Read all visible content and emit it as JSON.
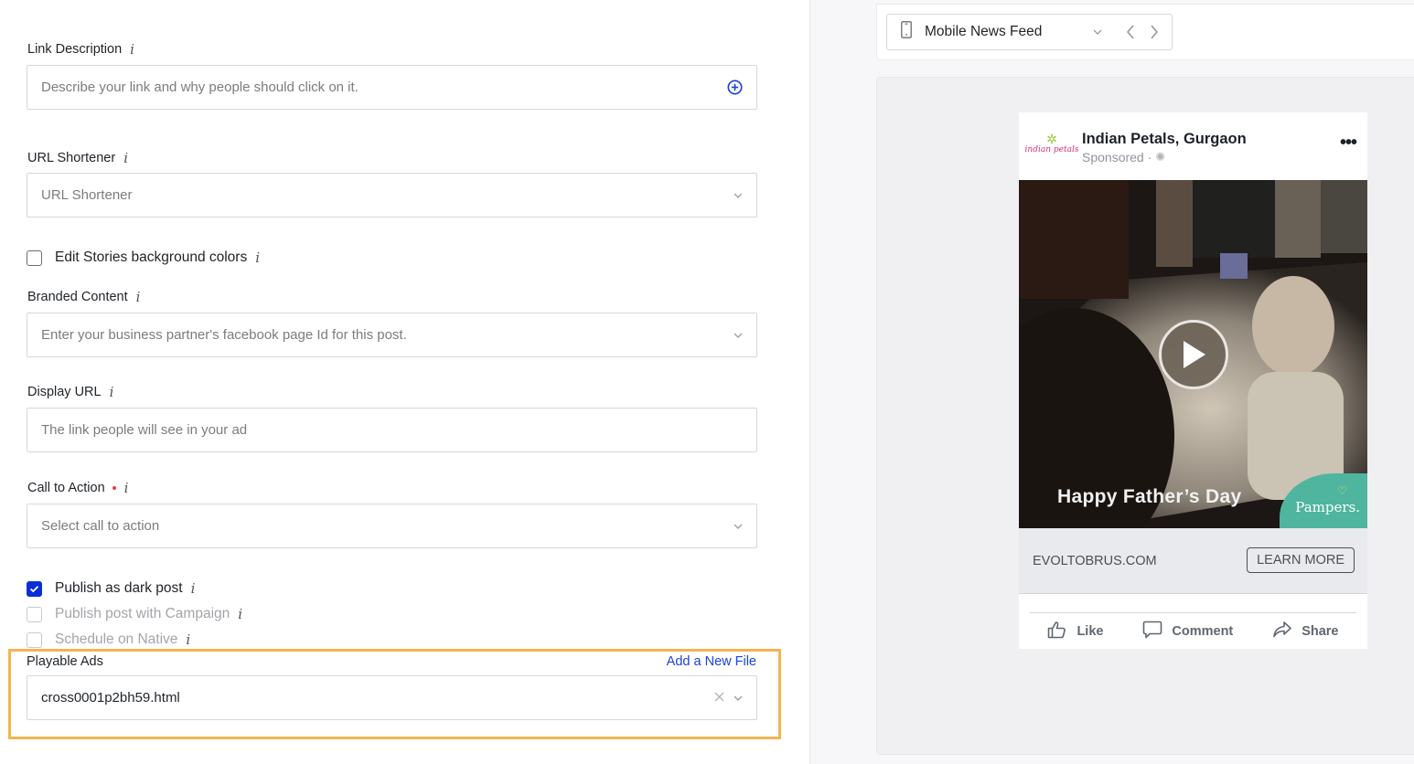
{
  "form": {
    "link_description": {
      "label": "Link Description",
      "info": "i",
      "placeholder": "Describe your link and why people should click on it."
    },
    "url_shortener": {
      "label": "URL Shortener",
      "info": "i",
      "placeholder": "URL Shortener"
    },
    "edit_stories_bg": {
      "label": "Edit Stories background colors",
      "info": "i",
      "checked": false
    },
    "branded_content": {
      "label": "Branded Content",
      "info": "i",
      "placeholder": "Enter your business partner's facebook page Id for this post."
    },
    "display_url": {
      "label": "Display URL",
      "info": "i",
      "placeholder": "The link people will see in your ad"
    },
    "call_to_action": {
      "label": "Call to Action",
      "required": true,
      "info": "i",
      "placeholder": "Select call to action"
    },
    "checkboxes": [
      {
        "label": "Publish as dark post",
        "checked": true,
        "disabled": false,
        "info": "i"
      },
      {
        "label": "Publish post with Campaign",
        "checked": false,
        "disabled": true,
        "info": "i"
      },
      {
        "label": "Schedule on Native",
        "checked": false,
        "disabled": true,
        "info": "i"
      }
    ],
    "playable_ads": {
      "label": "Playable Ads",
      "add_link": "Add a New File",
      "value": "cross0001p2bh59.html",
      "highlight_color": "#f4b352"
    }
  },
  "preview": {
    "placement": "Mobile News Feed",
    "placement_icon": "mobile-phone-icon",
    "ad": {
      "page_name": "Indian Petals, Gurgaon",
      "logo_text": "indian petals",
      "sponsored": "Sponsored · ",
      "overlay_text": "Happy Father’s Day",
      "brand_badge": "Pampers.",
      "domain": "EVOLTOBRUS.COM",
      "cta": "LEARN MORE",
      "actions": [
        {
          "label": "Like",
          "icon": "thumbs-up-icon"
        },
        {
          "label": "Comment",
          "icon": "comment-icon"
        },
        {
          "label": "Share",
          "icon": "share-icon"
        }
      ]
    }
  },
  "colors": {
    "accent_blue": "#0a2fd6",
    "link_blue": "#1a44d8",
    "required_red": "#e0423c"
  }
}
